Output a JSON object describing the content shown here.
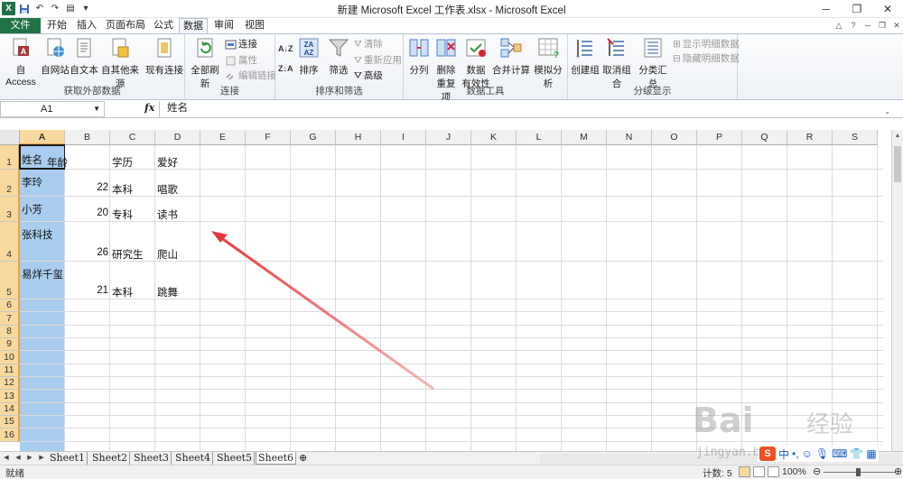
{
  "window": {
    "title": "新建 Microsoft Excel 工作表.xlsx - Microsoft Excel",
    "logo": "X",
    "controls": [
      "─",
      "❐",
      "✕"
    ]
  },
  "tabs": [
    {
      "label": "文件"
    },
    {
      "label": "开始"
    },
    {
      "label": "插入"
    },
    {
      "label": "页面布局"
    },
    {
      "label": "公式"
    },
    {
      "label": "数据"
    },
    {
      "label": "审阅"
    },
    {
      "label": "视图"
    }
  ],
  "active_tab": "数据",
  "ribbon": {
    "external": {
      "access": "自 Access",
      "web": "自网站",
      "text": "自文本",
      "other": "自其他来源",
      "existing": "现有连接",
      "group": "获取外部数据"
    },
    "connections": {
      "refresh": "全部刷新",
      "connect": "连接",
      "props": "属性",
      "edit": "编辑链接",
      "group": "连接"
    },
    "sort": {
      "sort": "排序",
      "filter": "筛选",
      "clear": "清除",
      "reapply": "重新应用",
      "advanced": "高级",
      "group": "排序和筛选"
    },
    "tools": {
      "split": "分列",
      "dedupe1": "删除",
      "dedupe2": "重复项",
      "valid1": "数据",
      "valid2": "有效性",
      "consolidate": "合并计算",
      "whatif": "模拟分析",
      "group": "数据工具"
    },
    "outline": {
      "group_btn": "创建组",
      "ungroup": "取消组合",
      "subtotal": "分类汇总",
      "show": "显示明细数据",
      "hide": "隐藏明细数据",
      "group": "分级显示"
    }
  },
  "formula_bar": {
    "name_box": "A1",
    "fx": "fx",
    "content": "姓名"
  },
  "columns": [
    "A",
    "B",
    "C",
    "D",
    "E",
    "F",
    "G",
    "H",
    "I",
    "J",
    "K",
    "L",
    "M",
    "N",
    "O",
    "P",
    "Q",
    "R",
    "S"
  ],
  "rows": [
    "1",
    "2",
    "3",
    "4",
    "5",
    "6",
    "7",
    "8",
    "9",
    "10",
    "11",
    "12",
    "13",
    "14",
    "15",
    "16"
  ],
  "cells": {
    "A1": "姓名",
    "B1": "年龄",
    "C1": "学历",
    "D1": "爱好",
    "A2": "李玲",
    "B2": "22",
    "C2": "本科",
    "D2": "唱歌",
    "A3": "小芳",
    "B3": "20",
    "C3": "专科",
    "D3": "读书",
    "A4": "张科技",
    "B4": "26",
    "C4": "研究生",
    "D4": "爬山",
    "A5": "易烊千玺",
    "B5": "21",
    "C5": "本科",
    "D5": "跳舞"
  },
  "sheets": [
    "Sheet1",
    "Sheet2",
    "Sheet3",
    "Sheet4",
    "Sheet5",
    "Sheet6"
  ],
  "active_sheet": "Sheet6",
  "status": {
    "ready": "就绪",
    "count": "计数: 5",
    "zoom": "100%"
  },
  "ime": {
    "s": "S",
    "lang": "中"
  },
  "watermark": {
    "brand": "Bai",
    "cn": "经验",
    "url": "jingyan.baidu.com"
  },
  "colors": {
    "excel_green": "#217346",
    "selection_fill": "#a9cdee",
    "header_highlight": "#f9d99f",
    "arrow": "#e8393a"
  }
}
